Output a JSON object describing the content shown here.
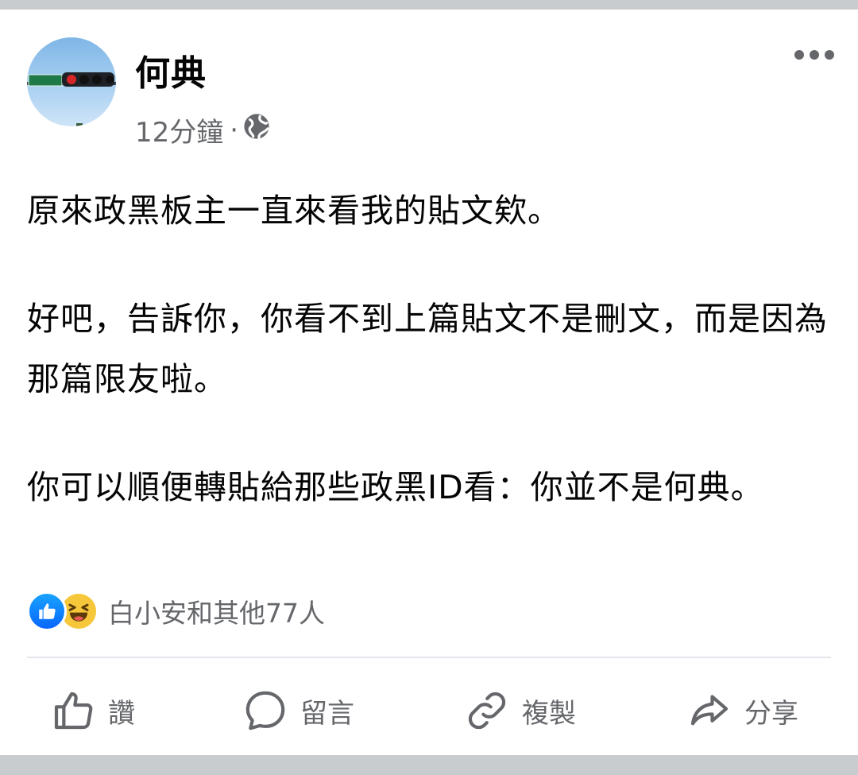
{
  "post": {
    "author": "何典",
    "time": "12分鐘",
    "separator": "·",
    "privacy_icon": "globe-icon",
    "paragraphs": [
      "原來政黑板主一直來看我的貼文欸。",
      "好吧，告訴你，你看不到上篇貼文不是刪文，而是因為那篇限友啦。",
      "你可以順便轉貼給那些政黑ID看：你並不是何典。"
    ],
    "reactions": {
      "icons": [
        "like-icon",
        "haha-icon"
      ],
      "summary": "白小安和其他77人"
    }
  },
  "actions": {
    "like": "讚",
    "comment": "留言",
    "copy": "複製",
    "share": "分享"
  },
  "colors": {
    "text": "#050505",
    "secondary": "#65676b",
    "like_blue": "#0866ff",
    "haha_yellow": "#f7c73b",
    "page_bg": "#c9cccf"
  }
}
